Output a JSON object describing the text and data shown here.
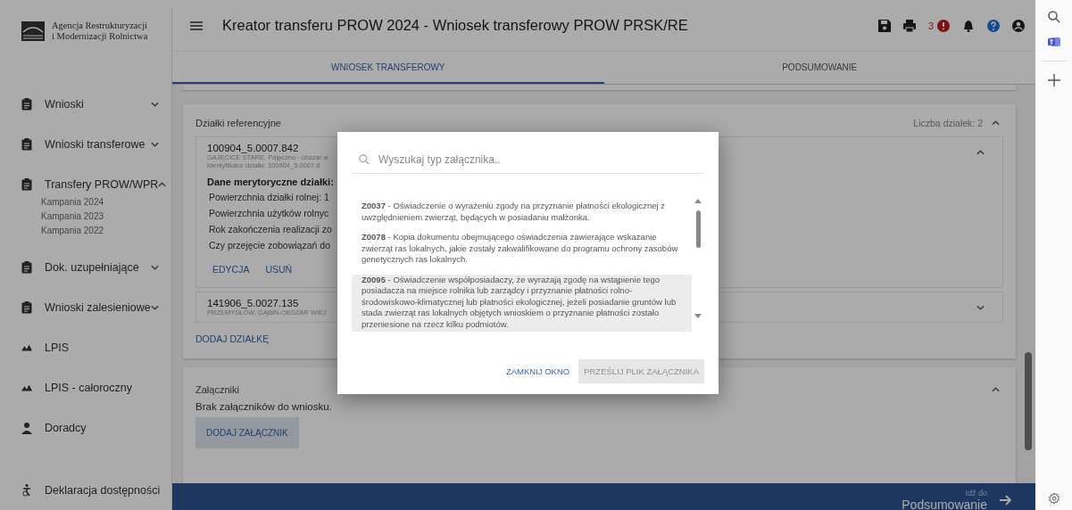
{
  "logo": {
    "lines": [
      "Agencja Restrukturyzacji",
      "i Modernizacji Rolnictwa"
    ]
  },
  "header": {
    "title": "Kreator transferu PROW 2024 - Wniosek transferowy PROW PRSK/RE",
    "error_count": "3"
  },
  "tabs": [
    {
      "label": "WNIOSEK TRANSFEROWY",
      "selected": true
    },
    {
      "label": "PODSUMOWANIE",
      "selected": false
    }
  ],
  "sidebar": {
    "items": [
      {
        "label": "Wnioski",
        "kind": "clipboard",
        "expanded": false
      },
      {
        "label": "Wnioski transferowe",
        "kind": "clipboard",
        "expanded": false
      },
      {
        "label": "Transfery PROW/WPR",
        "kind": "clipboard",
        "expanded": true,
        "children": [
          {
            "label": "Kampania 2024"
          },
          {
            "label": "Kampania 2023"
          },
          {
            "label": "Kampania 2022"
          }
        ]
      },
      {
        "label": "Dok. uzupełniające",
        "kind": "clipboard",
        "expanded": false
      },
      {
        "label": "Wnioski zalesieniowe",
        "kind": "clipboard",
        "expanded": false
      },
      {
        "label": "LPIS",
        "kind": "mountains"
      },
      {
        "label": "LPIS - całoroczny",
        "kind": "mountains"
      },
      {
        "label": "Doradcy",
        "kind": "person"
      }
    ],
    "footer_item": {
      "label": "Deklaracja dostępności",
      "kind": "accessibility"
    }
  },
  "parcels_section": {
    "title": "Działki referencyjne",
    "count": "Liczba działek: 2",
    "expanded": true,
    "parcels": [
      {
        "id": "100904_5.0007.842",
        "location": "GAJĘCICE STARE, Pajęczno - obszar w",
        "identifier": "Identyfikator działki: 100904_5.0007.8",
        "expanded": true,
        "details_title": "Dane merytoryczne działki:",
        "details": [
          "Powierzchnia działki rolnej: 1",
          "Powierzchnia użytków rolnyc",
          "Rok zakończenia realizacji zo",
          "Czy przejęcie zobowiązań do"
        ],
        "actions": [
          "EDYCJA",
          "USUŃ"
        ]
      },
      {
        "id": "141906_5.0027.135",
        "location": "PRZEMYSŁÓW, GĄBIN-OBSZAR WIEJ",
        "expanded": false
      }
    ],
    "add_button": "DODAJ DZIAŁKĘ"
  },
  "attachments_section": {
    "title": "Załączniki",
    "empty_text": "Brak załączników do wniosku.",
    "expanded": true,
    "add_button": "DODAJ ZAŁĄCZNIK"
  },
  "footer_bar": {
    "hint": "Idź do",
    "target": "Podsumowanie"
  },
  "modal": {
    "search": {
      "placeholder": "Wyszukaj typ załącznika.."
    },
    "items": [
      {
        "text": "**Z0037** - Oświadczenie o wyrażeniu zgody na przyznanie płatności ekologicznej z uwzględnieniem zwierząt, będących w posiadaniu małżonka.",
        "selected": false
      },
      {
        "text": "**Z0078** - Kopia dokumentu obejmującego oświadczenia zawierające wskazanie zwierząt ras lokalnych, jakie zostały zakwalifikowane do programu ochrony zasobów genetycznych ras lokalnych.",
        "selected": false
      },
      {
        "text": "**Z0095** - Oświadczenie współposiadaczy, że wyrażają zgodę na wstąpienie tego posiadacza na miejsce rolnika lub zarządcy i przyznanie płatności rolno-środowiskowo-klimatycznej lub płatności ekologicznej, jeżeli posiadanie gruntów lub stada zwierząt ras lokalnych objętych wnioskiem o przyznanie płatności zostało przeniesione na rzecz kilku podmiotów.",
        "selected": true
      }
    ],
    "close_button": "ZAMKNIJ OKNO",
    "submit_button": {
      "label": "PRZEŚLIJ PLIK ZAŁĄCZNIKA",
      "disabled": true
    }
  }
}
